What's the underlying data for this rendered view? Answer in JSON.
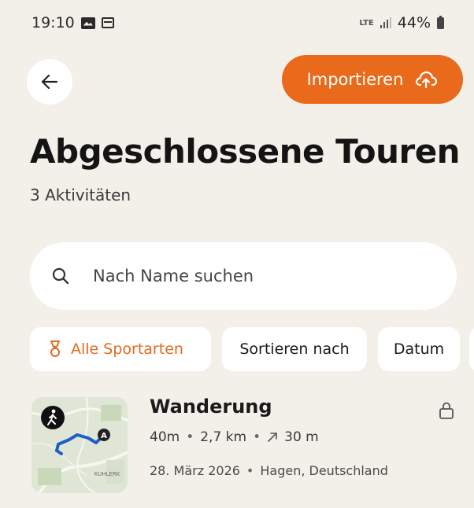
{
  "status_bar": {
    "time": "19:10",
    "network": "LTE",
    "battery": "44%"
  },
  "header": {
    "import_label": "Importieren",
    "title": "Abgeschlossene Touren",
    "count_label": "3 Aktivitäten"
  },
  "search": {
    "placeholder": "Nach Name suchen",
    "value": ""
  },
  "filters": {
    "sport_label": "Alle Sportarten",
    "sort_label": "Sortieren nach",
    "date_label": "Datum"
  },
  "tours": [
    {
      "name": "Wanderung",
      "duration": "40m",
      "distance": "2,7 km",
      "elevation": "30 m",
      "date": "28. März 2026",
      "location": "Hagen, Deutschland",
      "map_label": "KUHLERK"
    }
  ],
  "colors": {
    "accent": "#e96a1a",
    "background": "#f3f0ea",
    "route": "#1f5fc8"
  },
  "icons": {
    "back": "arrow-left-icon",
    "import": "cloud-upload-icon",
    "search": "search-icon",
    "sport": "medal-icon",
    "lock": "lock-icon",
    "activity": "hiker-icon",
    "elevation": "arrow-up-right-icon"
  }
}
